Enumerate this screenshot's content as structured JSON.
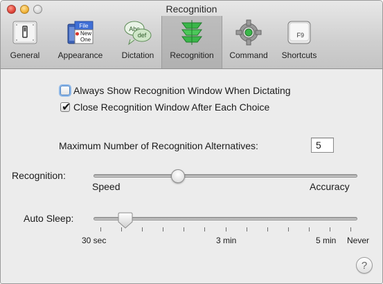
{
  "window": {
    "title": "Recognition"
  },
  "toolbar": {
    "items": [
      {
        "label": "General",
        "icon": "switch-icon",
        "selected": false
      },
      {
        "label": "Appearance",
        "icon": "menu-icon",
        "selected": false
      },
      {
        "label": "Dictation",
        "icon": "speech-bubbles-icon",
        "selected": false
      },
      {
        "label": "Recognition",
        "icon": "recognition-arrows-icon",
        "selected": true
      },
      {
        "label": "Command",
        "icon": "gear-icon",
        "selected": false
      },
      {
        "label": "Shortcuts",
        "icon": "f9-key-icon",
        "selected": false
      }
    ],
    "appearance_icon_text": {
      "file": "File",
      "new": "New",
      "one": "One"
    },
    "dictation_icon_text": {
      "abc": "Abc",
      "def": "def"
    },
    "shortcuts_icon_text": "F9"
  },
  "options": {
    "always_show_label": "Always Show Recognition Window When Dictating",
    "always_show_checked": false,
    "close_window_label": "Close Recognition Window After Each Choice",
    "close_window_checked": true,
    "check_glyph": "✔"
  },
  "alternatives": {
    "label": "Maximum Number of Recognition Alternatives:",
    "value": "5"
  },
  "recognition_slider": {
    "label": "Recognition:",
    "min_label": "Speed",
    "max_label": "Accuracy",
    "value": 0.32
  },
  "auto_sleep_slider": {
    "label": "Auto Sleep:",
    "tick_labels": [
      "30 sec",
      "3 min",
      "5 min",
      "Never"
    ],
    "value": 0.12
  },
  "help": {
    "label": "?"
  },
  "colors": {
    "close": "#e0443a",
    "minimize": "#f2b43a",
    "recognition_icon": "#3bb64a",
    "checkbox_focus": "#4d85c7"
  }
}
